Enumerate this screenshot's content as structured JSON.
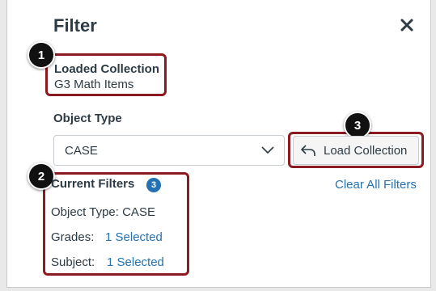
{
  "header": {
    "title": "Filter",
    "close_icon": "close-icon"
  },
  "loaded_collection": {
    "label": "Loaded Collection",
    "value": "G3 Math Items"
  },
  "object_type": {
    "label": "Object Type",
    "selected": "CASE"
  },
  "load_button": {
    "label": "Load Collection",
    "icon": "undo-arrow-icon"
  },
  "current_filters": {
    "label": "Current Filters",
    "count": "3",
    "clear_all": "Clear All Filters",
    "object_type_line": "Object Type: CASE",
    "grades_label": "Grades:",
    "grades_value": "1 Selected",
    "subject_label": "Subject:",
    "subject_value": "1 Selected"
  },
  "callouts": [
    "1",
    "2",
    "3"
  ],
  "colors": {
    "accent": "#2472b3",
    "callout_border": "#8b1a21",
    "text": "#2d3b45"
  }
}
